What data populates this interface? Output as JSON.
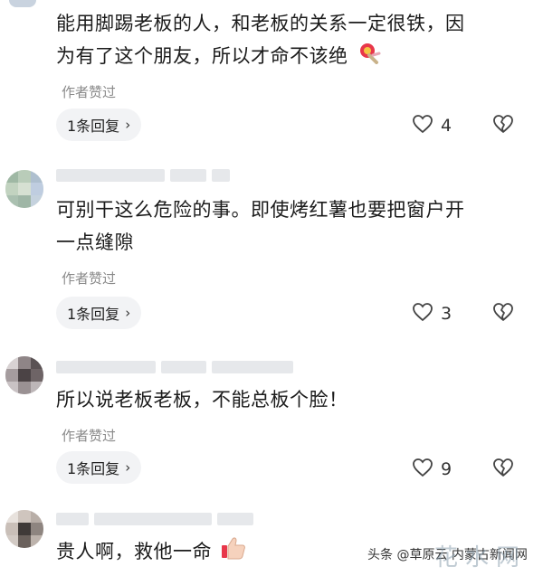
{
  "colors": {
    "text": "#1b1b1b",
    "muted": "#8a8a8a",
    "pill_bg": "#f2f3f5"
  },
  "comments": [
    {
      "text_line1": "能用脚踢老板的人，和老板的关系一定很铁，因",
      "text_line2": "为有了这个朋友，所以才命不该绝",
      "emoji": "rose-emoji",
      "liked_by_author": "作者赞过",
      "reply_label": "1条回复",
      "like_count": "4"
    },
    {
      "text_line1": "可别干这么危险的事。即使烤红薯也要把窗户开",
      "text_line2": "一点缝隙",
      "liked_by_author": "作者赞过",
      "reply_label": "1条回复",
      "like_count": "3"
    },
    {
      "text_line1": "所以说老板老板，不能总板个脸！",
      "liked_by_author": "作者赞过",
      "reply_label": "1条回复",
      "like_count": "9"
    },
    {
      "text_line1": "贵人啊，救他一命",
      "emoji": "thumbs-up-emoji"
    }
  ],
  "watermark": {
    "source": "头条 @草原云 内蒙古新闻网",
    "logo": "花水网"
  }
}
